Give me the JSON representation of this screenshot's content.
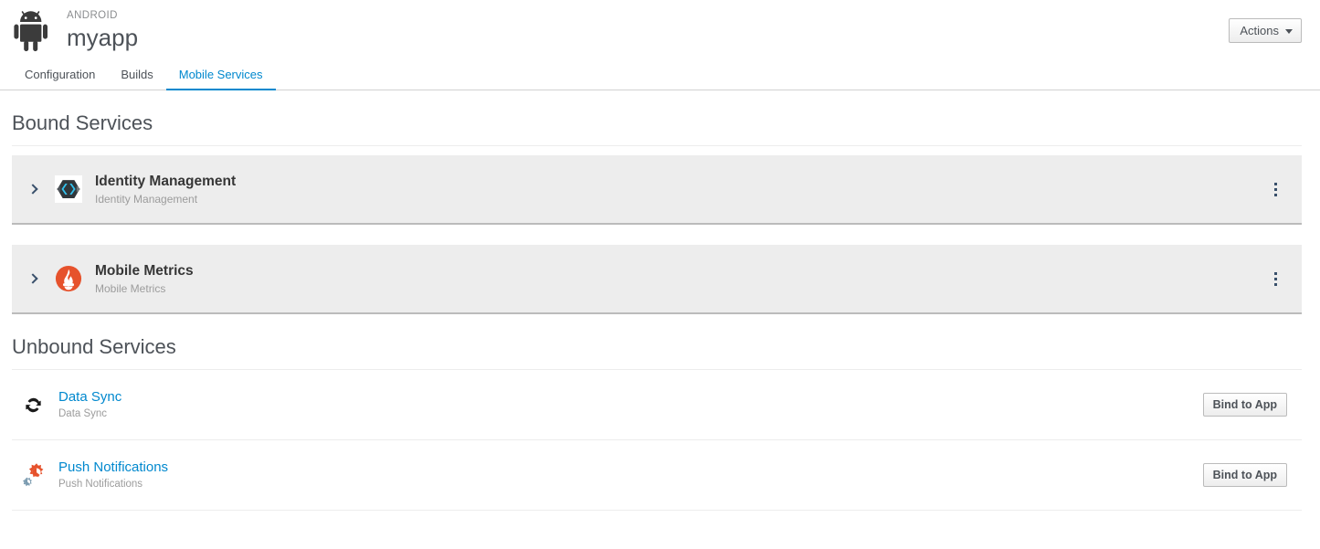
{
  "header": {
    "kind_label": "ANDROID",
    "app_name": "myapp",
    "logo_icon": "android-robot-icon",
    "actions_label": "Actions",
    "actions_caret_icon": "chevron-down-icon"
  },
  "tabs": [
    {
      "label": "Configuration",
      "active": false
    },
    {
      "label": "Builds",
      "active": false
    },
    {
      "label": "Mobile Services",
      "active": true
    }
  ],
  "bound_section": {
    "title": "Bound Services",
    "services": [
      {
        "name": "Identity Management",
        "subtitle": "Identity Management",
        "icon": "keycloak-hexagon-icon",
        "expander_icon": "chevron-right-icon",
        "menu_icon": "kebab-menu-icon"
      },
      {
        "name": "Mobile Metrics",
        "subtitle": "Mobile Metrics",
        "icon": "prometheus-flame-icon",
        "expander_icon": "chevron-right-icon",
        "menu_icon": "kebab-menu-icon"
      }
    ]
  },
  "unbound_section": {
    "title": "Unbound Services",
    "bind_label": "Bind to App",
    "services": [
      {
        "name": "Data Sync",
        "subtitle": "Data Sync",
        "icon": "sync-arrows-icon",
        "bind_label": "Bind to App"
      },
      {
        "name": "Push Notifications",
        "subtitle": "Push Notifications",
        "icon": "unifiedpush-gears-icon",
        "bind_label": "Bind to App"
      }
    ]
  },
  "colors": {
    "accent_blue": "#0088ce",
    "row_gray": "#ededed",
    "text_dark": "#363636",
    "text_muted": "#9c9c9c",
    "prometheus_orange": "#e6522c",
    "keycloak_cyan": "#33c2ee"
  }
}
